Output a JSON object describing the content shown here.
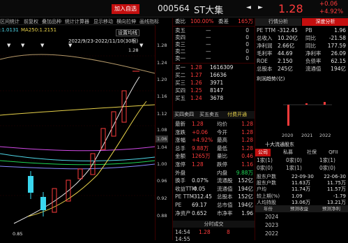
{
  "header": {
    "add_fav": "加入自选",
    "code": "000564",
    "name": "ST大集",
    "price": "1.28",
    "change": "+0.06",
    "pct": "+4.92%"
  },
  "chart_tools": [
    "区间统计",
    "前复权",
    "叠加品种",
    "统计计算器",
    "显示移动",
    "横向拉伸",
    "画线",
    "指标"
  ],
  "chart_info": {
    "ma": ":1.0131",
    "ma250": "MA250:1.2151",
    "settings": "设置均线",
    "range": "2022/9/23-2022/11/10(30根)",
    "high": "1.28",
    "low": "0.85"
  },
  "price_axis": [
    "1.28",
    "1.24",
    "1.20",
    "1.16",
    "1.12",
    "1.08",
    "1.06",
    "1.04",
    "1.00",
    "0.96",
    "0.92",
    "0.88"
  ],
  "orderbook": {
    "weibi": {
      "label": "委比",
      "value": "100.00%",
      "label2": "委差",
      "value2": "165万"
    },
    "sells": [
      {
        "l": "卖五",
        "p": "—",
        "v": "0"
      },
      {
        "l": "卖四",
        "p": "—",
        "v": "0"
      },
      {
        "l": "卖三",
        "p": "—",
        "v": "0"
      },
      {
        "l": "卖二",
        "p": "—",
        "v": "0"
      },
      {
        "l": "卖一",
        "p": "—",
        "v": "0"
      }
    ],
    "buys": [
      {
        "l": "买一",
        "p": "1.28",
        "v": "1616309"
      },
      {
        "l": "买二",
        "p": "1.27",
        "v": "16636"
      },
      {
        "l": "买三",
        "p": "1.26",
        "v": "3971"
      },
      {
        "l": "买四",
        "p": "1.25",
        "v": "8147"
      },
      {
        "l": "买五",
        "p": "1.24",
        "v": "3678"
      }
    ],
    "bar": {
      "a": "买四卖四",
      "b": "买五卖五",
      "c": "付费开通"
    }
  },
  "stats": [
    {
      "a": "最新",
      "av": "1.28",
      "b": "均价",
      "bv": "1.28"
    },
    {
      "a": "涨跌",
      "av": "+0.06",
      "b": "今开",
      "bv": "1.28"
    },
    {
      "a": "涨幅",
      "av": "+4.92%",
      "b": "最高",
      "bv": "1.28"
    },
    {
      "a": "总手",
      "av": "9.88万",
      "b": "最低",
      "bv": "1.28"
    },
    {
      "a": "金额",
      "av": "1265万",
      "b": "量比",
      "bv": "0.46"
    },
    {
      "a": "涨停",
      "av": "1.28",
      "b": "跌停",
      "bv": "1.16"
    },
    {
      "a": "外盘",
      "av": "",
      "b": "内盘",
      "bv": "9.88万"
    },
    {
      "a": "换手",
      "av": "0.07%",
      "b": "流通股",
      "bv": "152亿"
    },
    {
      "a": "收益TTM",
      "av": "-0.05",
      "b": "流通值",
      "bv": "194亿"
    },
    {
      "a": "PE TTM",
      "av": "-312.45",
      "b": "总股本",
      "bv": "152亿"
    },
    {
      "a": "PE",
      "av": "69.17",
      "b": "总市值",
      "bv": "194亿"
    },
    {
      "a": "净资产",
      "av": "0.652",
      "b": "市净率",
      "bv": "1.96"
    }
  ],
  "trades": {
    "title": "分时成交",
    "time": "14:54",
    "price": "1.28",
    "vol": "8",
    "time2": "14:55"
  },
  "right": {
    "tab1": "行情分析",
    "tab2": "深度分析",
    "metrics": [
      {
        "a": "PE TTM",
        "av": "-312.45",
        "b": "PB",
        "bv": "1.96"
      },
      {
        "a": "总收入",
        "av": "10.20亿",
        "b": "同比",
        "bv": "-21.58"
      },
      {
        "a": "净利润",
        "av": "2.66亿",
        "b": "同比",
        "bv": "177.59"
      },
      {
        "a": "毛利率",
        "av": "44.69",
        "b": "净利率",
        "bv": "26.09"
      },
      {
        "a": "ROE",
        "av": "2.150",
        "b": "负债率",
        "bv": "62.15"
      },
      {
        "a": "总股本",
        "av": "245亿",
        "b": "流通值",
        "bv": "194亿"
      }
    ],
    "chart_title": "利润趋势(亿)",
    "years": [
      "2020",
      "2021",
      "2022"
    ],
    "holders_title": "十大流通股东",
    "holder_tabs": [
      "公司",
      "私募",
      "社保",
      "QFII"
    ],
    "holder_rows": [
      {
        "a": "1家(1)",
        "b": "0家(0)",
        "c": "1家(1)"
      },
      {
        "a": "0家(0)",
        "b": "1家(1)",
        "c": "0家(0)"
      }
    ],
    "info": [
      {
        "a": "股东户数",
        "b": "22-09-30",
        "c": "22-06-30"
      },
      {
        "a": "股东户数",
        "b": "11.63万",
        "c": "11.75万"
      },
      {
        "a": "户均",
        "b": "11.74万",
        "c": "11.57万"
      },
      {
        "a": "较上期(%)",
        "b": "1.09",
        "c": "-1.79"
      },
      {
        "a": "人均持股",
        "b": "13.06万",
        "c": "13.21万"
      }
    ],
    "forecast": {
      "h1": "年份",
      "h2": "预测收益",
      "h3": "预测净利",
      "rows": [
        "2024",
        "2023",
        "2022"
      ]
    }
  }
}
